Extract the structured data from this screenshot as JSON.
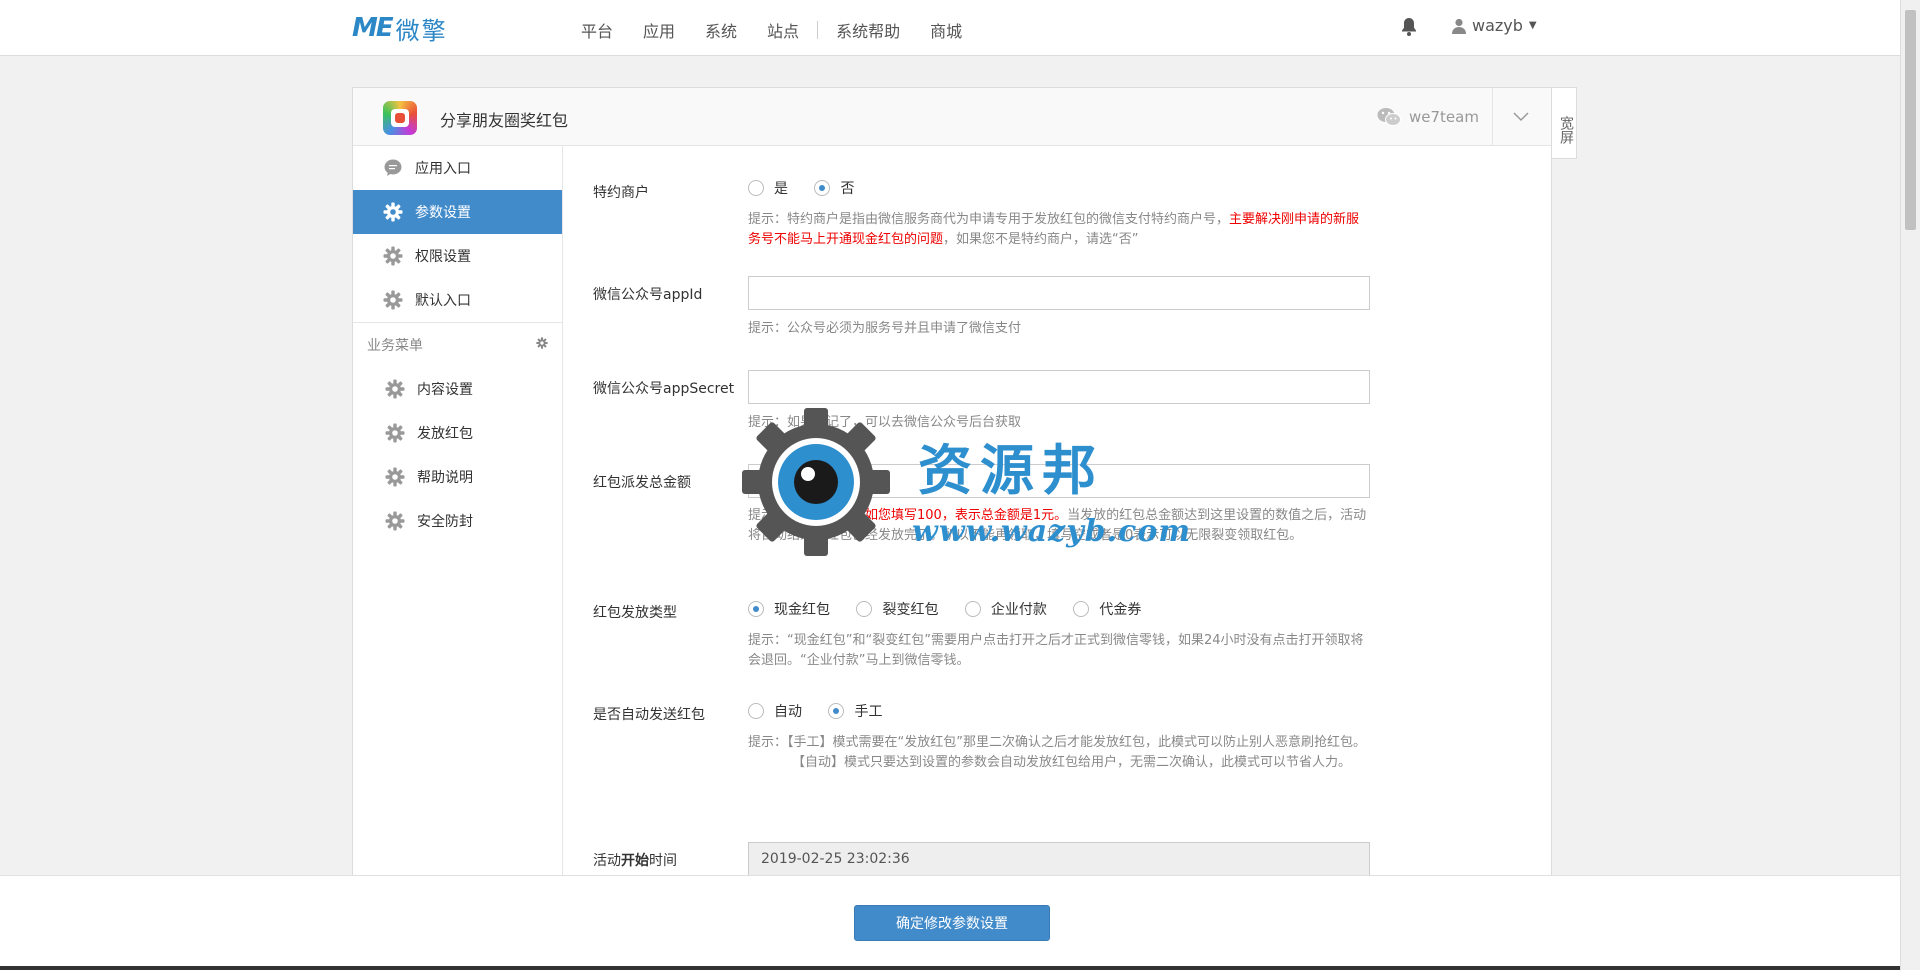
{
  "brand": {
    "mark": "ME",
    "name": "微擎"
  },
  "nav": {
    "items": [
      "平台",
      "应用",
      "系统",
      "站点",
      "系统帮助",
      "商城"
    ]
  },
  "user": {
    "name": "wazyb"
  },
  "panel": {
    "title": "分享朋友圈奖红包",
    "account": "we7team",
    "wide_label": "宽屏"
  },
  "sidebar": {
    "items": [
      {
        "label": "应用入口",
        "icon": "chat-icon"
      },
      {
        "label": "参数设置",
        "icon": "gear-icon",
        "active": true
      },
      {
        "label": "权限设置",
        "icon": "gear-icon"
      },
      {
        "label": "默认入口",
        "icon": "gear-icon"
      }
    ],
    "group_label": "业务菜单",
    "group_items": [
      {
        "label": "内容设置",
        "icon": "gear-icon"
      },
      {
        "label": "发放红包",
        "icon": "gear-icon"
      },
      {
        "label": "帮助说明",
        "icon": "gear-icon"
      },
      {
        "label": "安全防封",
        "icon": "gear-icon"
      }
    ]
  },
  "form": {
    "special": {
      "label": "特约商户",
      "opt_yes": "是",
      "opt_no": "否",
      "hint_a": "提示：特约商户是指由微信服务商代为申请专用于发放红包的微信支付特约商户号，",
      "hint_red": "主要解决刚申请的新服务号不能马上开通现金红包的问题",
      "hint_b": "，如果您不是特约商户，请选“否”"
    },
    "appid": {
      "label": "微信公众号appId",
      "value": "",
      "hint": "提示：公众号必须为服务号并且申请了微信支付"
    },
    "secret": {
      "label": "微信公众号appSecret",
      "value": "",
      "hint": "提示：如果忘记了，可以去微信公众号后台获取"
    },
    "total": {
      "label": "红包派发总金额",
      "value": "",
      "hint_a": "提示：",
      "hint_red": "单位为分，如如您填写100，表示总金额是1元。",
      "hint_b": "当发放的红包总金额达到这里设置的数值之后，活动将自动结束，红包已经发放完了。所以不能再领取，填写空或者是0表示可以无限裂变领取红包。"
    },
    "type": {
      "label": "红包发放类型",
      "options": [
        "现金红包",
        "裂变红包",
        "企业付款",
        "代金券"
      ],
      "hint": "提示：“现金红包”和“裂变红包”需要用户点击打开之后才正式到微信零钱，如果24小时没有点击打开领取将会退回。“企业付款”马上到微信零钱。"
    },
    "auto": {
      "label": "是否自动发送红包",
      "opt_auto": "自动",
      "opt_manual": "手工",
      "hint_1": "提示：【手工】模式需要在“发放红包”那里二次确认之后才能发放红包，此模式可以防止别人恶意刷抢红包。",
      "hint_2": "【自动】模式只要达到设置的参数会自动发放红包给用户，无需二次确认，此模式可以节省人力。"
    },
    "start": {
      "label_a": "活动",
      "label_b": "开始",
      "label_c": "时间",
      "value": "2019-02-25 23:02:36"
    }
  },
  "footer": {
    "submit": "确定修改参数设置"
  },
  "watermark": {
    "text": "资源邦",
    "url": "www.wazyb.com"
  },
  "colors": {
    "accent": "#428bca",
    "brand": "#2c87c7",
    "warning": "#e00000"
  }
}
